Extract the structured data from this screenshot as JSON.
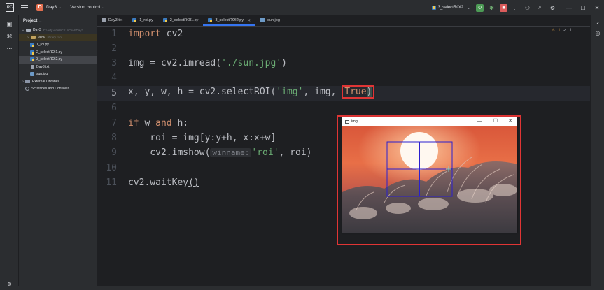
{
  "titlebar": {
    "project_badge": "D",
    "project_name": "Day3",
    "version_control": "Version control",
    "run_config": "3_selectROI2"
  },
  "project_panel": {
    "title": "Project",
    "root": {
      "name": "Day3",
      "path": "C:\\aiffj.vu\\AI\\CS1\\CVAI\\Day3"
    },
    "items": [
      {
        "name": "venv",
        "note": "library root"
      },
      {
        "name": "1_roi.py"
      },
      {
        "name": "2_selectROI1.py"
      },
      {
        "name": "3_selectROI2.py"
      },
      {
        "name": "Day3.txt"
      },
      {
        "name": "sun.jpg"
      },
      {
        "name": "External Libraries"
      },
      {
        "name": "Scratches and Consoles"
      }
    ]
  },
  "tabs": [
    {
      "label": "Day3.txt"
    },
    {
      "label": "1_roi.py"
    },
    {
      "label": "2_selectROI1.py"
    },
    {
      "label": "3_selectROI2.py"
    },
    {
      "label": "sun.jpg"
    }
  ],
  "inspection": {
    "warnings": "1",
    "ok": "1"
  },
  "editor": {
    "lines": [
      "1",
      "2",
      "3",
      "4",
      "5",
      "6",
      "7",
      "8",
      "9",
      "10",
      "11"
    ],
    "code": {
      "l1_kw": "import",
      "l1_rest": " cv2",
      "l3_a": "img = cv2.imread(",
      "l3_str": "'./sun.jpg'",
      "l3_b": ")",
      "l5_a": "x, y, w, h = cv2.selectROI(",
      "l5_str": "'img'",
      "l5_b": ", img, ",
      "l5_true": "True",
      "l5_close": ")",
      "l7_kw1": "if",
      "l7_a": " w ",
      "l7_kw2": "and",
      "l7_b": " h:",
      "l8": "    roi = img[y:y+h, x:x+w]",
      "l9_a": "    cv2.imshow(",
      "l9_hint": "winname:",
      "l9_str": "'roi'",
      "l9_b": ", roi)",
      "l11_a": "cv2.waitKey",
      "l11_b": "()"
    }
  },
  "cv_window": {
    "title": "img",
    "minimize": "—",
    "maximize": "☐",
    "close": "✕"
  }
}
